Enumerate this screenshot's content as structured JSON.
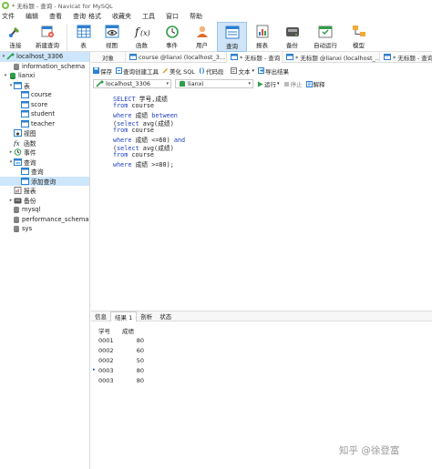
{
  "window": {
    "title": "* 无标题 - 查询 - Navicat for MySQL"
  },
  "menu": [
    "文件",
    "编辑",
    "查看",
    "查询",
    "格式",
    "工具",
    "收藏夹",
    "工具",
    "窗口",
    "帮助"
  ],
  "toolbar": {
    "connect": "连接",
    "new_query": "新建查询",
    "table": "表",
    "view": "视图",
    "function": "函数",
    "event": "事件",
    "user": "用户",
    "query": "查询",
    "report": "报表",
    "backup": "备份",
    "automation": "自动运行",
    "model": "模型"
  },
  "sidebar": {
    "connection": "localhost_3306",
    "db_information_schema": "information_schema",
    "db_lianxi": "lianxi",
    "node_tables": "表",
    "table_course": "course",
    "table_score": "score",
    "table_student": "student",
    "table_teacher": "teacher",
    "node_views": "视图",
    "node_functions": "函数",
    "node_events": "事件",
    "node_queries": "查询",
    "query_item": "查询",
    "query_add": "添加查询",
    "node_reports": "报表",
    "node_backups": "备份",
    "db_mysql": "mysql",
    "db_performance_schema": "performance_schema",
    "db_sys": "sys"
  },
  "tabs": {
    "objects": "对象",
    "tab1": "course @lianxi (localhost_3...",
    "tab2": "* 无标题 - 查询",
    "tab3": "* 无标题 @lianxi (localhost_...",
    "tab4": "* 无标题 - 查询"
  },
  "query_toolbar": {
    "save": "保存",
    "builder": "查询创建工具",
    "beautify": "美化 SQL",
    "snippet": "代码段",
    "text": "文本",
    "export": "导出结果"
  },
  "connection_bar": {
    "connection": "localhost_3306",
    "database": "lianxi",
    "run": "运行",
    "stop": "停止",
    "explain": "解释"
  },
  "editor": {
    "lines": [
      [
        {
          "t": "SELECT ",
          "c": "kw"
        },
        {
          "t": "学号,成绩",
          "c": "tx"
        }
      ],
      [
        {
          "t": "from ",
          "c": "kw"
        },
        {
          "t": "course",
          "c": "tx"
        }
      ],
      [
        {
          "t": "where ",
          "c": "kw"
        },
        {
          "t": "成绩 ",
          "c": "tx"
        },
        {
          "t": "between",
          "c": "kw"
        }
      ],
      [
        {
          "t": "(",
          "c": "tx"
        },
        {
          "t": "select ",
          "c": "kw"
        },
        {
          "t": "avg(成绩)",
          "c": "tx"
        }
      ],
      [
        {
          "t": "from ",
          "c": "kw"
        },
        {
          "t": "course",
          "c": "tx"
        }
      ],
      [
        {
          "t": "where ",
          "c": "kw"
        },
        {
          "t": "成绩 <=60) ",
          "c": "tx"
        },
        {
          "t": "and",
          "c": "kw"
        }
      ],
      [
        {
          "t": "(",
          "c": "tx"
        },
        {
          "t": "select ",
          "c": "kw"
        },
        {
          "t": "avg(成绩)",
          "c": "tx"
        }
      ],
      [
        {
          "t": "from ",
          "c": "kw"
        },
        {
          "t": "course",
          "c": "tx"
        }
      ],
      [
        {
          "t": "where ",
          "c": "kw"
        },
        {
          "t": "成绩 >=80);",
          "c": "tx"
        }
      ]
    ]
  },
  "result_tabs": [
    "信息",
    "结果 1",
    "剖析",
    "状态"
  ],
  "result": {
    "columns": [
      "学号",
      "成绩"
    ],
    "rows": [
      [
        "0001",
        "80"
      ],
      [
        "0002",
        "60"
      ],
      [
        "0002",
        "50"
      ],
      [
        "0003",
        "80"
      ],
      [
        "0003",
        "80"
      ]
    ],
    "current_row": 3
  },
  "watermark": "知乎 @徐登富",
  "colors": {
    "accent": "#1d6fc4",
    "selection": "#cde6fb",
    "keyword": "#1d3fbf"
  }
}
